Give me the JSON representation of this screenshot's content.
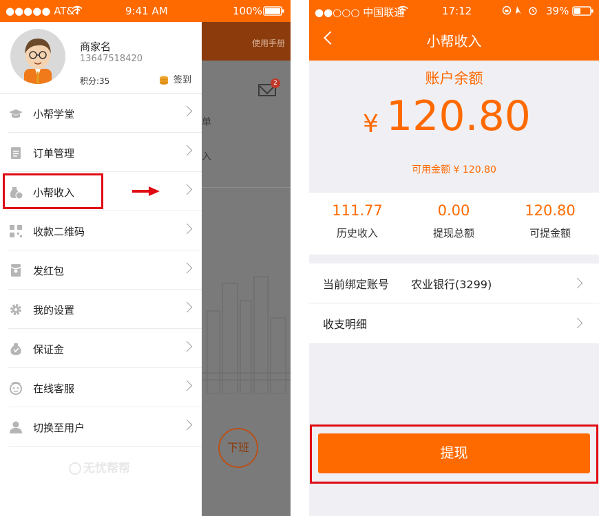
{
  "left_phone": {
    "status": {
      "signal": "●●●●● AT&T",
      "time": "9:41 AM",
      "battery": "100%"
    },
    "background_app": {
      "header_link": "使用手册",
      "badge": "2",
      "fragments": [
        "单",
        "入"
      ],
      "offduty_button": "下班"
    },
    "profile": {
      "name": "商家名",
      "phone": "13647518420",
      "points": "积分:35",
      "checkin": "签到"
    },
    "menu": [
      {
        "label": "小帮学堂",
        "icon": "graduation-cap-icon"
      },
      {
        "label": "订单管理",
        "icon": "clipboard-icon"
      },
      {
        "label": "小帮收入",
        "icon": "money-bag-icon"
      },
      {
        "label": "收款二维码",
        "icon": "qr-code-icon"
      },
      {
        "label": "发红包",
        "icon": "red-envelope-icon"
      },
      {
        "label": "我的设置",
        "icon": "gear-icon"
      },
      {
        "label": "保证金",
        "icon": "deposit-bag-icon"
      },
      {
        "label": "在线客服",
        "icon": "customer-service-icon"
      },
      {
        "label": "切换至用户",
        "icon": "user-icon"
      }
    ],
    "logo": "无忧帮帮",
    "highlight_color": "#e00a14"
  },
  "right_phone": {
    "status": {
      "signal": "●●○○○ 中国联通",
      "time": "17:12",
      "battery": "39%"
    },
    "nav_title": "小帮收入",
    "balance": {
      "title": "账户余额",
      "currency": "¥",
      "amount": "120.80",
      "available": "可用金额 ¥ 120.80"
    },
    "stats": [
      {
        "value": "111.77",
        "label": "历史收入"
      },
      {
        "value": "0.00",
        "label": "提现总额"
      },
      {
        "value": "120.80",
        "label": "可提金额"
      }
    ],
    "account_row": {
      "label": "当前绑定账号",
      "value": "农业银行(3299)"
    },
    "detail_row": {
      "label": "收支明细"
    },
    "withdraw_button": "提现",
    "accent_color": "#ff6a00"
  }
}
